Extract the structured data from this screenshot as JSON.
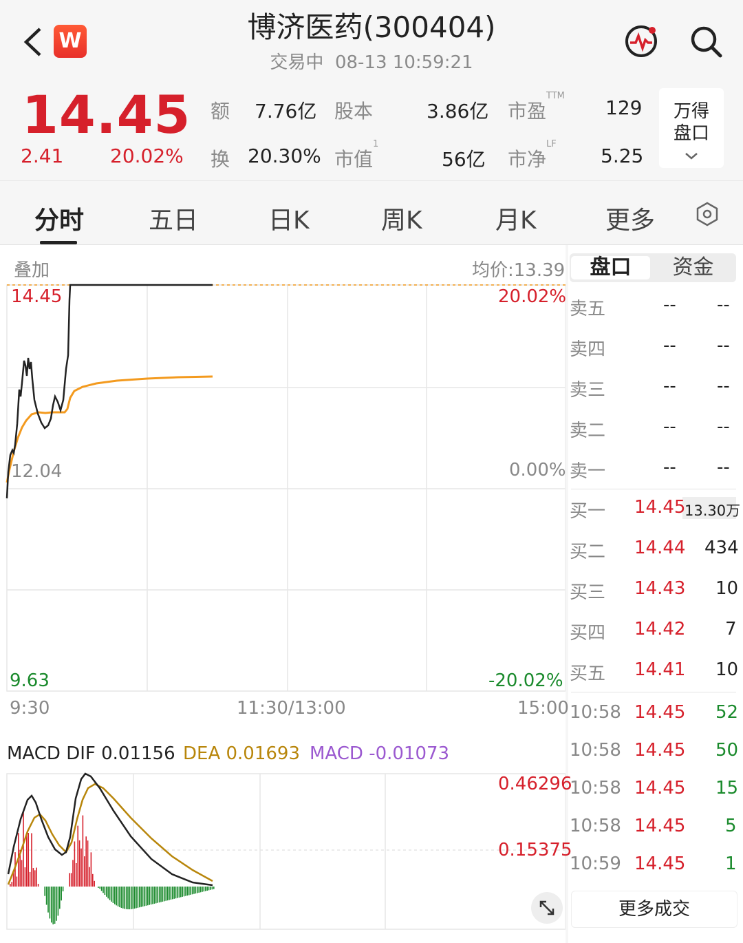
{
  "header": {
    "title": "博济医药(300404)",
    "status": "交易中",
    "datetime": "08-13 10:59:21",
    "logo": "W"
  },
  "quote": {
    "price": "14.45",
    "change": "2.41",
    "change_pct": "20.02%",
    "amount_label": "额",
    "amount": "7.76亿",
    "turnover_label": "换",
    "turnover": "20.30%",
    "share_label": "股本",
    "share": "3.86亿",
    "mktcap_label": "市值",
    "mktcap_sup": "1",
    "mktcap": "56亿",
    "pe_label": "市盈",
    "pe_sup": "TTM",
    "pe": "129",
    "pb_label": "市净",
    "pb_sup": "LF",
    "pb": "5.25",
    "wande_line1": "万得",
    "wande_line2": "盘口"
  },
  "tabs": [
    "分时",
    "五日",
    "日K",
    "周K",
    "月K",
    "更多"
  ],
  "chart": {
    "overlay_label": "叠加",
    "avg_label": "均价:13.39",
    "price_high": "14.45",
    "price_mid": "12.04",
    "price_low": "9.63",
    "pct_high": "20.02%",
    "pct_mid": "0.00%",
    "pct_low": "-20.02%",
    "time_start": "9:30",
    "time_mid": "11:30/13:00",
    "time_end": "15:00"
  },
  "macd": {
    "dif": "MACD DIF 0.01156",
    "dea": "DEA 0.01693",
    "macd": "MACD -0.01073",
    "axis_high": "0.46296",
    "axis_mid": "0.15375"
  },
  "panel": {
    "tab_orderbook": "盘口",
    "tab_capital": "资金",
    "asks": [
      {
        "label": "卖五",
        "price": "--",
        "vol": "--"
      },
      {
        "label": "卖四",
        "price": "--",
        "vol": "--"
      },
      {
        "label": "卖三",
        "price": "--",
        "vol": "--"
      },
      {
        "label": "卖二",
        "price": "--",
        "vol": "--"
      },
      {
        "label": "卖一",
        "price": "--",
        "vol": "--"
      }
    ],
    "bids": [
      {
        "label": "买一",
        "price": "14.45",
        "vol": "13.30万"
      },
      {
        "label": "买二",
        "price": "14.44",
        "vol": "434"
      },
      {
        "label": "买三",
        "price": "14.43",
        "vol": "10"
      },
      {
        "label": "买四",
        "price": "14.42",
        "vol": "7"
      },
      {
        "label": "买五",
        "price": "14.41",
        "vol": "10"
      }
    ],
    "trades": [
      {
        "time": "10:58",
        "price": "14.45",
        "vol": "52"
      },
      {
        "time": "10:58",
        "price": "14.45",
        "vol": "50"
      },
      {
        "time": "10:58",
        "price": "14.45",
        "vol": "15"
      },
      {
        "time": "10:58",
        "price": "14.45",
        "vol": "5"
      },
      {
        "time": "10:59",
        "price": "14.45",
        "vol": "1"
      }
    ],
    "more_trades": "更多成交"
  },
  "colors": {
    "up": "#d6202b",
    "down": "#1a8a2c",
    "price_line": "#222222",
    "avg_line": "#f39a1e",
    "dea_line": "#b8860b",
    "macd_text": "#9b59d0"
  }
}
